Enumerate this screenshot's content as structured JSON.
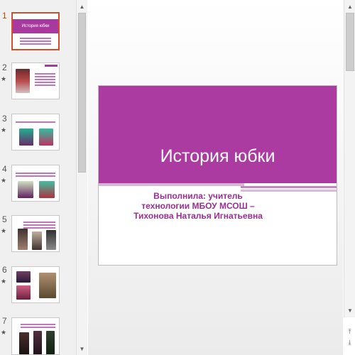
{
  "slides": [
    {
      "num": "1",
      "star": "",
      "title": "История юбки"
    },
    {
      "num": "2",
      "star": "★"
    },
    {
      "num": "3",
      "star": "★"
    },
    {
      "num": "4",
      "star": "★"
    },
    {
      "num": "5",
      "star": "★"
    },
    {
      "num": "6",
      "star": "★"
    },
    {
      "num": "7",
      "star": "★"
    }
  ],
  "main_slide": {
    "title": "История юбки",
    "subtitle_line1": "Выполнила: учитель",
    "subtitle_line2": "технологии МБОУ МСОШ –",
    "subtitle_line3": "Тихонова Наталья Игнатьевна"
  },
  "scroll": {
    "up": "▲",
    "down": "▼",
    "prev": "⤒",
    "next": "⤓"
  },
  "colors": {
    "accent": "#ab3aa1",
    "selected": "#d84a28"
  }
}
